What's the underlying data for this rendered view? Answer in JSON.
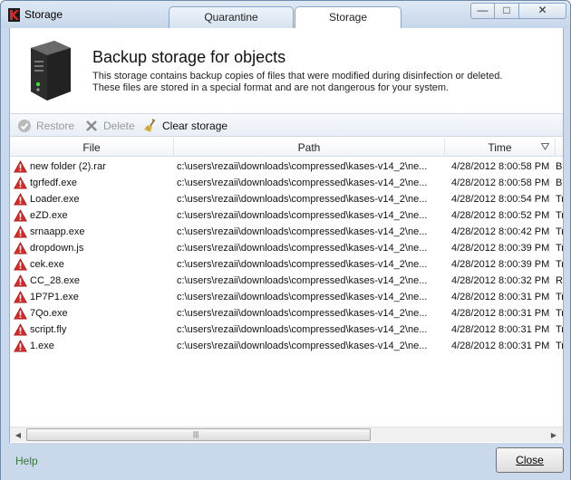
{
  "window": {
    "title": "Storage",
    "tabs": [
      {
        "label": "Quarantine",
        "active": false
      },
      {
        "label": "Storage",
        "active": true
      }
    ],
    "controls": {
      "minimize": "—",
      "maximize": "□",
      "close": "✕"
    }
  },
  "header": {
    "title": "Backup storage for objects",
    "description_line1": "This storage contains backup copies of files that were modified during disinfection or deleted.",
    "description_line2": "These files are stored in a special format and are not dangerous for your system."
  },
  "toolbar": {
    "restore_label": "Restore",
    "delete_label": "Delete",
    "clear_label": "Clear storage"
  },
  "table": {
    "columns": [
      "File",
      "Path",
      "Time"
    ],
    "rows": [
      {
        "file": "new folder (2).rar",
        "path": "c:\\users\\rezaii\\downloads\\compressed\\kases-v14_2\\ne...",
        "time": "4/28/2012 8:00:58 PM",
        "extra": "B"
      },
      {
        "file": "tgrfedf.exe",
        "path": "c:\\users\\rezaii\\downloads\\compressed\\kases-v14_2\\ne...",
        "time": "4/28/2012 8:00:58 PM",
        "extra": "B"
      },
      {
        "file": "Loader.exe",
        "path": "c:\\users\\rezaii\\downloads\\compressed\\kases-v14_2\\ne...",
        "time": "4/28/2012 8:00:54 PM",
        "extra": "Tr"
      },
      {
        "file": "eZD.exe",
        "path": "c:\\users\\rezaii\\downloads\\compressed\\kases-v14_2\\ne...",
        "time": "4/28/2012 8:00:52 PM",
        "extra": "Tr"
      },
      {
        "file": "srnaapp.exe",
        "path": "c:\\users\\rezaii\\downloads\\compressed\\kases-v14_2\\ne...",
        "time": "4/28/2012 8:00:42 PM",
        "extra": "Tr"
      },
      {
        "file": "dropdown.js",
        "path": "c:\\users\\rezaii\\downloads\\compressed\\kases-v14_2\\ne...",
        "time": "4/28/2012 8:00:39 PM",
        "extra": "Tr"
      },
      {
        "file": "cek.exe",
        "path": "c:\\users\\rezaii\\downloads\\compressed\\kases-v14_2\\ne...",
        "time": "4/28/2012 8:00:39 PM",
        "extra": "Tr"
      },
      {
        "file": "CC_28.exe",
        "path": "c:\\users\\rezaii\\downloads\\compressed\\kases-v14_2\\ne...",
        "time": "4/28/2012 8:00:32 PM",
        "extra": "R"
      },
      {
        "file": "1P7P1.exe",
        "path": "c:\\users\\rezaii\\downloads\\compressed\\kases-v14_2\\ne...",
        "time": "4/28/2012 8:00:31 PM",
        "extra": "Tr"
      },
      {
        "file": "7Qo.exe",
        "path": "c:\\users\\rezaii\\downloads\\compressed\\kases-v14_2\\ne...",
        "time": "4/28/2012 8:00:31 PM",
        "extra": "Tr"
      },
      {
        "file": "script.fly",
        "path": "c:\\users\\rezaii\\downloads\\compressed\\kases-v14_2\\ne...",
        "time": "4/28/2012 8:00:31 PM",
        "extra": "Tr"
      },
      {
        "file": "1.exe",
        "path": "c:\\users\\rezaii\\downloads\\compressed\\kases-v14_2\\ne...",
        "time": "4/28/2012 8:00:31 PM",
        "extra": "Tr"
      }
    ]
  },
  "footer": {
    "help_label": "Help",
    "close_label": "Close"
  },
  "icons": {
    "row_status": "warning-icon",
    "restore": "restore-icon",
    "delete": "delete-icon",
    "clear": "broom-icon"
  },
  "colors": {
    "frame": "#c9d8ea",
    "warning": "#d42a2a",
    "help_link": "#3a7a3a"
  }
}
